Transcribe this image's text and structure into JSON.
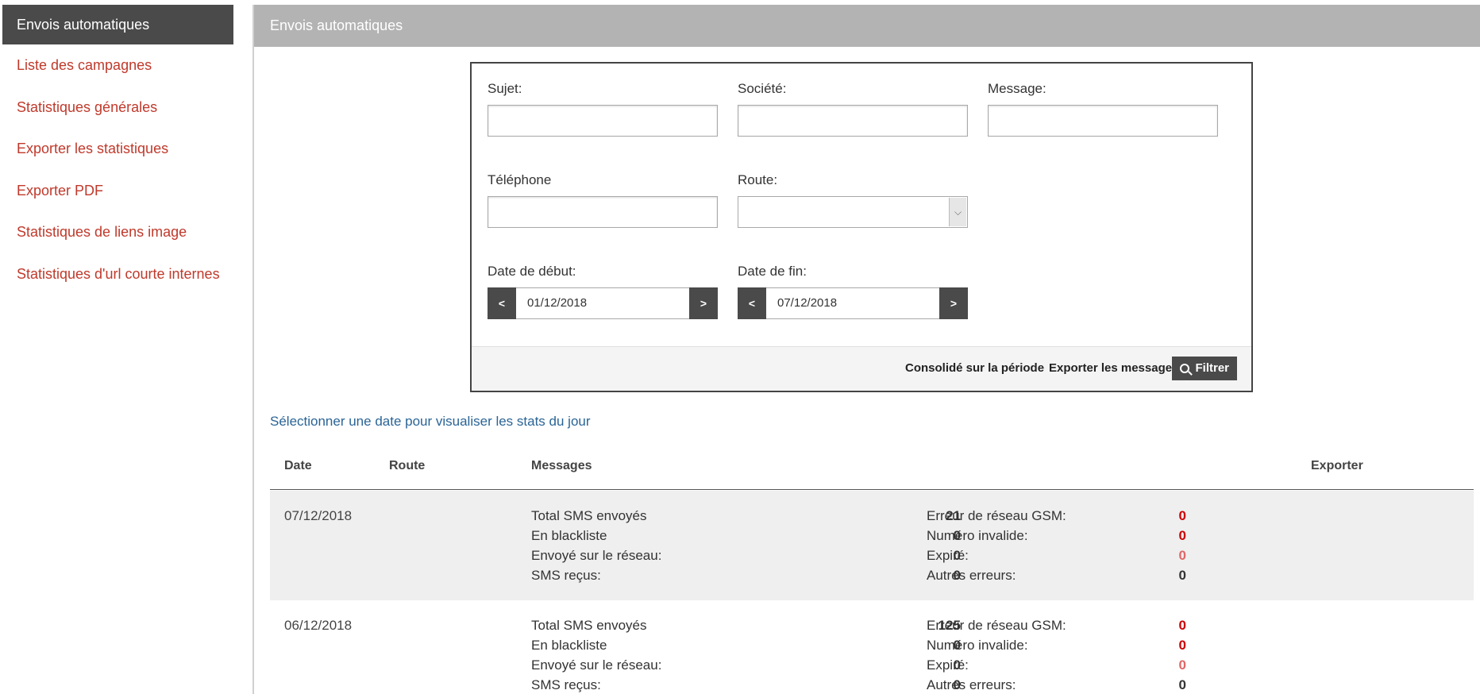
{
  "sidebar": {
    "active": "Envois automatiques",
    "items": [
      {
        "label": "Liste des campagnes"
      },
      {
        "label": "Statistiques générales"
      },
      {
        "label": "Exporter les statistiques"
      },
      {
        "label": "Exporter PDF"
      },
      {
        "label": "Statistiques de liens image"
      },
      {
        "label": "Statistiques d'url courte internes"
      }
    ]
  },
  "header": {
    "title": "Envois automatiques"
  },
  "filter": {
    "subject_label": "Sujet:",
    "company_label": "Société:",
    "message_label": "Message:",
    "phone_label": "Téléphone",
    "route_label": "Route:",
    "start_label": "Date de début:",
    "end_label": "Date de fin:",
    "start_value": "01/12/2018",
    "end_value": "07/12/2018",
    "prev": "<",
    "next": ">",
    "consolidate": "Consolidé sur la période",
    "export_messages": "Exporter les messages",
    "filter_button": "Filtrer"
  },
  "hint": "Sélectionner une date pour visualiser les stats du jour",
  "table": {
    "headers": {
      "date": "Date",
      "route": "Route",
      "messages": "Messages",
      "export": "Exporter"
    },
    "labels": {
      "total": "Total SMS envoyés",
      "blacklist": "En blackliste",
      "network": "Envoyé sur le réseau:",
      "received": "SMS reçus:",
      "gsm": "Erreur de réseau GSM:",
      "invalid": "Numéro invalide:",
      "expired": "Expiré:",
      "other": "Autres erreurs:"
    },
    "rows": [
      {
        "date": "07/12/2018",
        "total": "21",
        "blacklist": "0",
        "network": "0",
        "received": "0",
        "gsm": "0",
        "invalid": "0",
        "expired": "0",
        "other": "0"
      },
      {
        "date": "06/12/2018",
        "total": "125",
        "blacklist": "0",
        "network": "0",
        "received": "0",
        "gsm": "0",
        "invalid": "0",
        "expired": "0",
        "other": "0"
      }
    ]
  },
  "colors": {
    "accent": "#c0392b",
    "dark": "#4a4a4a",
    "header": "#b3b3b3",
    "error": "#cc0000",
    "link": "#2a6496"
  }
}
